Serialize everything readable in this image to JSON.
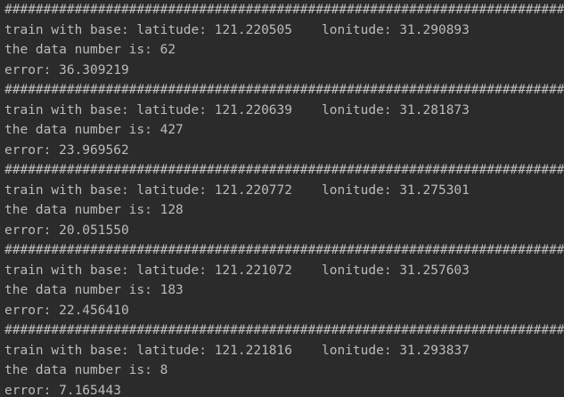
{
  "console": {
    "separator": "#############################################################################",
    "entries": [
      {
        "base_line": "train with base: latitude: 121.220505",
        "lonitude": "lonitude: 31.290893",
        "count_line": "the data number is: 62",
        "error_line": "error: 36.309219"
      },
      {
        "base_line": "train with base: latitude: 121.220639",
        "lonitude": "lonitude: 31.281873",
        "count_line": "the data number is: 427",
        "error_line": "error: 23.969562"
      },
      {
        "base_line": "train with base: latitude: 121.220772",
        "lonitude": "lonitude: 31.275301",
        "count_line": "the data number is: 128",
        "error_line": "error: 20.051550"
      },
      {
        "base_line": "train with base: latitude: 121.221072",
        "lonitude": "lonitude: 31.257603",
        "count_line": "the data number is: 183",
        "error_line": "error: 22.456410"
      },
      {
        "base_line": "train with base: latitude: 121.221816",
        "lonitude": "lonitude: 31.293837",
        "count_line": "the data number is: 8",
        "error_line": "error: 7.165443"
      }
    ]
  },
  "colors": {
    "background": "#2b2b2b",
    "text": "#bbbbbb"
  }
}
